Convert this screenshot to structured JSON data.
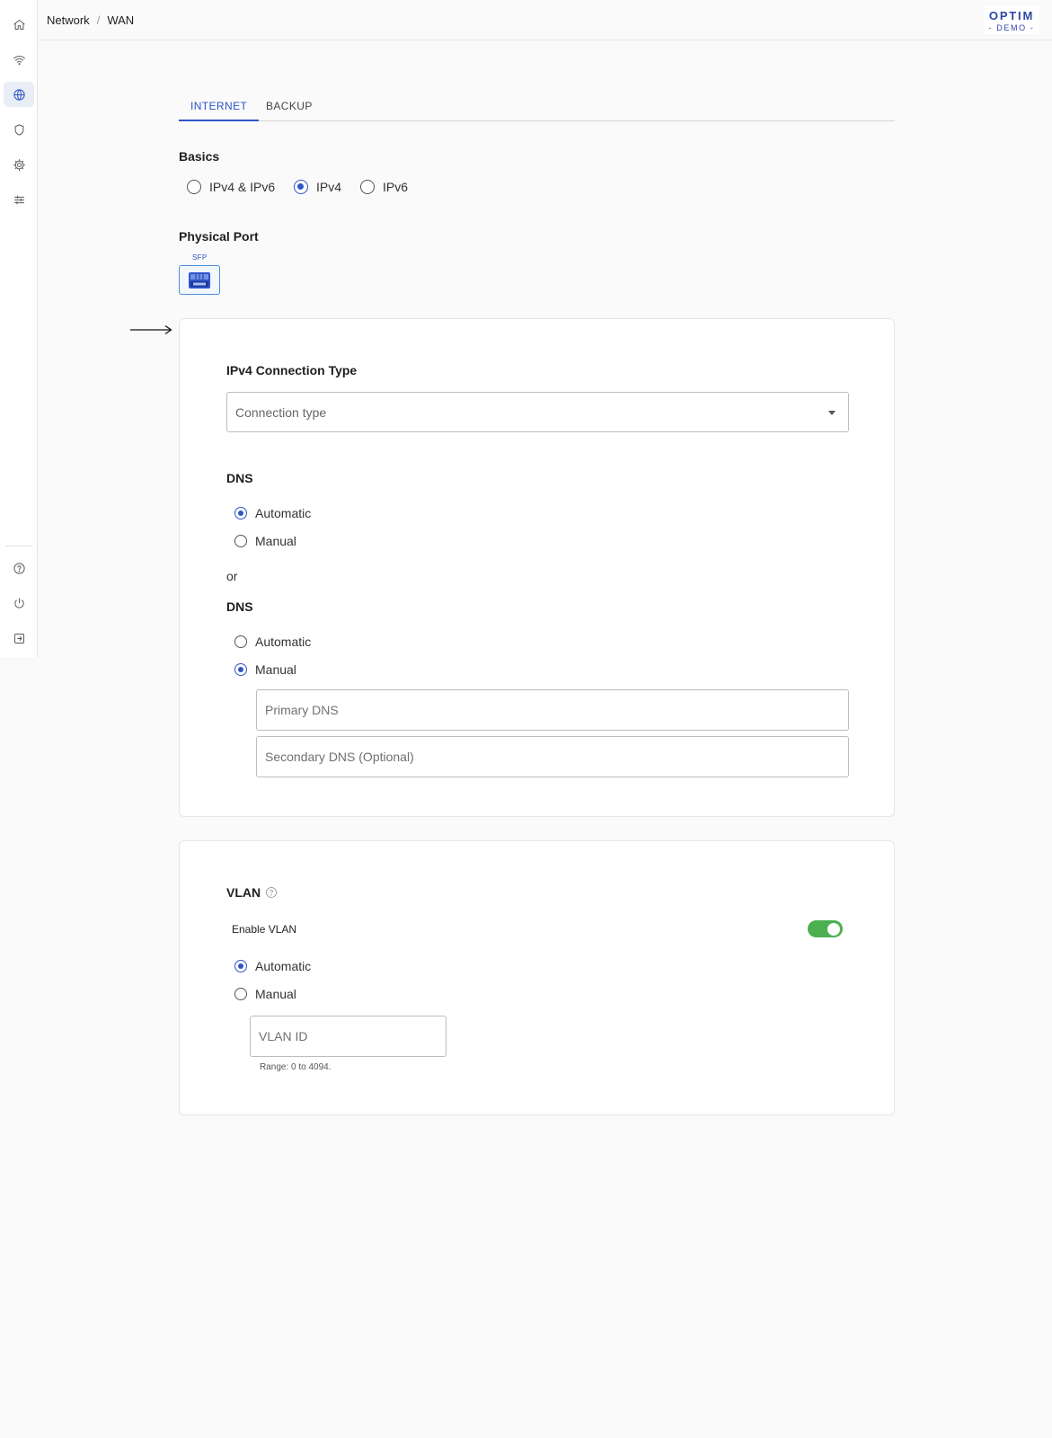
{
  "breadcrumb": {
    "section": "Network",
    "separator": "/",
    "page": "WAN"
  },
  "logo": {
    "line1": "OPTIM",
    "line2": "- DEMO -"
  },
  "sidebar": {
    "top_items": [
      "home-icon",
      "wifi-icon",
      "globe-icon",
      "shield-icon",
      "gear-icon",
      "sliders-icon"
    ],
    "bottom_items": [
      "help-icon",
      "power-icon",
      "logout-icon"
    ],
    "active": "globe-icon"
  },
  "tabs": [
    {
      "label": "INTERNET",
      "active": true
    },
    {
      "label": "BACKUP",
      "active": false
    }
  ],
  "basics": {
    "title": "Basics",
    "options": [
      {
        "label": "IPv4 & IPv6",
        "checked": false
      },
      {
        "label": "IPv4",
        "checked": true
      },
      {
        "label": "IPv6",
        "checked": false
      }
    ]
  },
  "physical_port": {
    "title": "Physical Port",
    "port_label": "SFP"
  },
  "ipv4": {
    "title": "IPv4 Connection Type",
    "select_placeholder": "Connection type",
    "dns1": {
      "title": "DNS",
      "options": [
        {
          "label": "Automatic",
          "checked": true
        },
        {
          "label": "Manual",
          "checked": false
        }
      ]
    },
    "or_text": "or",
    "dns2": {
      "title": "DNS",
      "options": [
        {
          "label": "Automatic",
          "checked": false
        },
        {
          "label": "Manual",
          "checked": true
        }
      ],
      "primary_placeholder": "Primary DNS",
      "secondary_placeholder": "Secondary DNS (Optional)"
    }
  },
  "vlan": {
    "title": "VLAN",
    "enable_label": "Enable VLAN",
    "enabled": true,
    "options": [
      {
        "label": "Automatic",
        "checked": true
      },
      {
        "label": "Manual",
        "checked": false
      }
    ],
    "id_placeholder": "VLAN ID",
    "range_hint": "Range: 0 to 4094."
  },
  "colors": {
    "accent": "#2f54c8",
    "toggle_on": "#4caf50",
    "port_border": "#4a8fd8"
  }
}
